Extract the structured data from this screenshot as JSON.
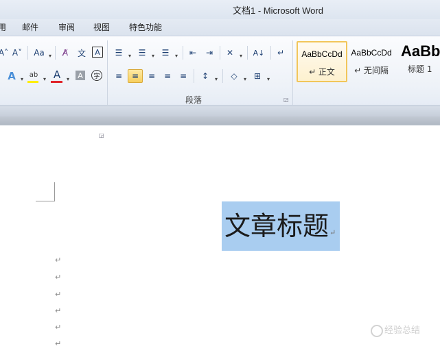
{
  "window": {
    "title": "文档1  -  Microsoft Word"
  },
  "tabs": [
    {
      "label": "用"
    },
    {
      "label": "邮件"
    },
    {
      "label": "审阅"
    },
    {
      "label": "视图"
    },
    {
      "label": "特色功能"
    }
  ],
  "font_group": {
    "grow_font_glyph": "A˄",
    "shrink_font_glyph": "A˅",
    "change_case_glyph": "Aa",
    "clear_format_glyph": "A̸",
    "phonetic_glyph": "文",
    "char_border_glyph": "A",
    "text_effect_glyph": "A",
    "highlight_glyph": "ab",
    "font_color_glyph": "A",
    "char_shading_glyph": "A",
    "enclose_char_glyph": "字"
  },
  "paragraph_group": {
    "label": "段落",
    "bullets_glyph": "☰",
    "numbering_glyph": "☰",
    "multilevel_glyph": "☰",
    "decrease_indent_glyph": "⇤",
    "increase_indent_glyph": "⇥",
    "chinese_layout_glyph": "✕",
    "sort_glyph": "A↓",
    "show_marks_glyph": "↵",
    "align_left_glyph": "≡",
    "center_glyph": "≡",
    "align_right_glyph": "≡",
    "justify_glyph": "≡",
    "distributed_glyph": "≡",
    "line_spacing_glyph": "↕",
    "shading_glyph": "◇",
    "borders_glyph": "⊞",
    "dropdown_glyph": "▾"
  },
  "styles_group": {
    "styles": [
      {
        "sample": "AaBbCcDd",
        "name": "↵ 正文"
      },
      {
        "sample": "AaBbCcDd",
        "name": "↵ 无间隔"
      },
      {
        "sample": "AaBb",
        "name": "标题 1"
      }
    ]
  },
  "document": {
    "title_text": "文章标题",
    "paragraph_mark": "↵",
    "empty_paragraphs": [
      "↵",
      "↵",
      "↵",
      "↵",
      "↵",
      "↵"
    ]
  },
  "watermark": {
    "text": "经验总结"
  },
  "colors": {
    "selection": "#a9cdf0",
    "highlight_bar": "#ffee00",
    "font_color_bar": "#e0242a",
    "selected_button": "#f7cf5e"
  }
}
